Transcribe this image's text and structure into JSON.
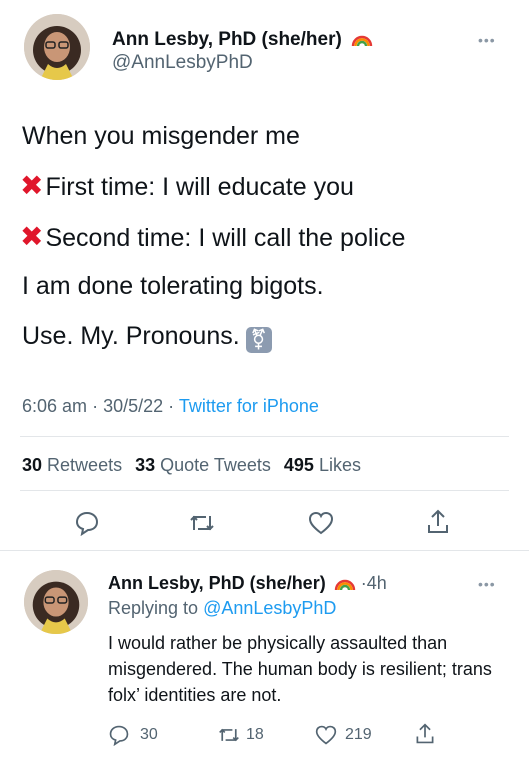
{
  "tweet": {
    "author": {
      "name": "Ann Lesby, PhD (she/her)",
      "handle": "@AnnLesbyPhD",
      "emoji_icon": "rainbow-icon"
    },
    "lines": [
      {
        "marker": "",
        "text": "When you misgender me"
      },
      {
        "marker": "x-mark-icon",
        "text": "First time: I will educate you"
      },
      {
        "marker": "x-mark-icon",
        "text": "Second time: I will call the police"
      },
      {
        "marker": "",
        "text": "I am done tolerating bigots."
      },
      {
        "marker": "",
        "text": "Use. My. Pronouns."
      }
    ],
    "pronoun_emoji": "transgender-symbol-icon",
    "time": "6:06 am",
    "date": "30/5/22",
    "source": "Twitter for iPhone",
    "stats": {
      "retweets": "30",
      "retweets_label": "Retweets",
      "quotes": "33",
      "quotes_label": "Quote Tweets",
      "likes": "495",
      "likes_label": "Likes"
    }
  },
  "reply": {
    "author": {
      "name": "Ann Lesby, PhD (she/her)",
      "emoji_icon": "rainbow-icon",
      "age": "4h"
    },
    "replying_to_prefix": "Replying to",
    "replying_to_handle": "@AnnLesbyPhD",
    "text": "I would rather be physically assaulted than misgendered. The human body is resilient; trans folx’ identities are not.",
    "counts": {
      "replies": "30",
      "retweets": "18",
      "likes": "219"
    }
  },
  "colors": {
    "accent": "#1d9bf0",
    "muted": "#536471",
    "x_mark": "#e0162b"
  }
}
